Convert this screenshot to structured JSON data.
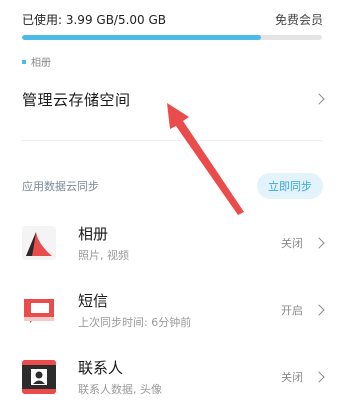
{
  "storage": {
    "used_text": "已使用: 3.99 GB/5.00 GB",
    "plan_label": "免费会员",
    "used_fraction": 0.798,
    "bar_color": "#4dbbe8",
    "legend_label": "相册"
  },
  "manage": {
    "label": "管理云存储空间"
  },
  "sync_section": {
    "title": "应用数据云同步",
    "sync_button_label": "立即同步",
    "button_bg": "#e3f3fb",
    "button_fg": "#3aa6d6"
  },
  "apps": [
    {
      "name": "相册",
      "subtitle": "照片, 视频",
      "status": "关闭",
      "icon": "gallery-icon"
    },
    {
      "name": "短信",
      "subtitle": "上次同步时间: 6分钟前",
      "status": "开启",
      "icon": "message-icon"
    },
    {
      "name": "联系人",
      "subtitle": "联系人数据, 头像",
      "status": "关闭",
      "icon": "contacts-icon"
    }
  ],
  "accent_red": "#ea4b4b"
}
